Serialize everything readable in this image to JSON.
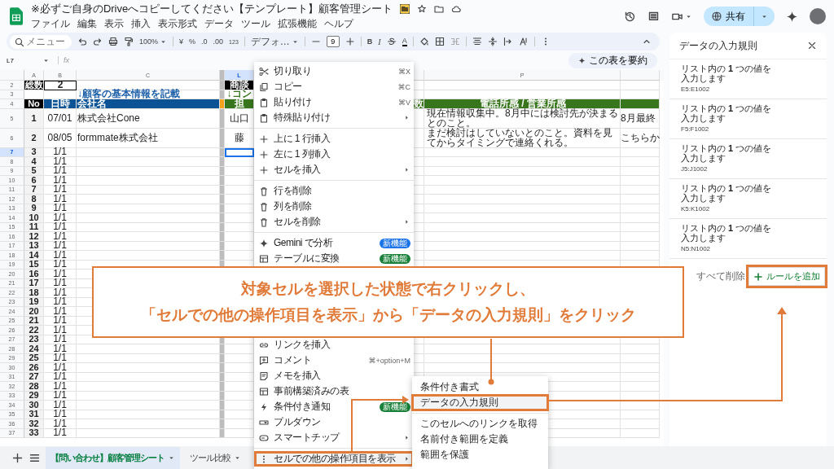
{
  "document": {
    "title": "※必ずご自身のDriveへコピーしてください【テンプレート】顧客管理シート",
    "menus": [
      "ファイル",
      "編集",
      "表示",
      "挿入",
      "表示形式",
      "データ",
      "ツール",
      "拡張機能",
      "ヘルプ"
    ],
    "share_label": "共有"
  },
  "toolbar": {
    "search_placeholder": "メニュー",
    "zoom": "100%",
    "currency": "¥",
    "percent": "%",
    "decrease_decimals": ".0",
    "increase_decimals": ".00",
    "number_format": "123",
    "font": "デフォ…",
    "font_size": "9",
    "bold": "B",
    "italic": "I",
    "text_color": "A"
  },
  "formula_bar": {
    "cell_ref": "L7",
    "fx": "fx",
    "summarize_button": "この表を要約"
  },
  "grid": {
    "column_headers": [
      {
        "letter": "A",
        "selected": false
      },
      {
        "letter": "B",
        "selected": false
      },
      {
        "letter": "C",
        "selected": false
      },
      {
        "letter": "L",
        "selected": true
      },
      {
        "letter": "P",
        "selected": false
      }
    ],
    "rows": [
      {
        "number": "2",
        "kind": "summary",
        "selected": false,
        "cells": {
          "A": "総数",
          "B": "2",
          "L": "商談"
        }
      },
      {
        "number": "3",
        "kind": "section",
        "selected": false,
        "cells": {
          "C": "↓顧客の基本情報を記載",
          "L": "↓コン"
        }
      },
      {
        "number": "4",
        "kind": "header",
        "selected": false,
        "cells": {
          "A": "No",
          "B": "日時",
          "C": "会社名",
          "L": "担",
          "O": "数",
          "P": "電話所感 / 営業所感"
        }
      },
      {
        "number": "5",
        "kind": "data",
        "selected": false,
        "cells": {
          "A": "1",
          "B": "07/01",
          "C": "株式会社Cone",
          "L": "山口",
          "P": "現在情報収集中。8月中には検討先が決まるとのこと。",
          "Q": "8月最終"
        }
      },
      {
        "number": "6",
        "kind": "data",
        "selected": false,
        "cells": {
          "A": "2",
          "B": "08/05",
          "C": "formmate株式会社",
          "L": "藤",
          "P": "まだ検討はしていないとのこと。資料を見てからタイミングで連絡くれる。",
          "Q": "こちらか"
        }
      },
      {
        "number": "7",
        "kind": "data",
        "selected": true,
        "cells": {
          "A": "3",
          "B": "1/1"
        }
      },
      {
        "number": "8",
        "kind": "data",
        "selected": false,
        "cells": {
          "A": "4",
          "B": "1/1"
        }
      },
      {
        "number": "9",
        "kind": "data",
        "selected": false,
        "cells": {
          "A": "5",
          "B": "1/1"
        }
      },
      {
        "number": "10",
        "kind": "data",
        "selected": false,
        "cells": {
          "A": "6",
          "B": "1/1"
        }
      },
      {
        "number": "11",
        "kind": "data",
        "selected": false,
        "cells": {
          "A": "7",
          "B": "1/1"
        }
      },
      {
        "number": "12",
        "kind": "data",
        "selected": false,
        "cells": {
          "A": "8",
          "B": "1/1"
        }
      },
      {
        "number": "13",
        "kind": "data",
        "selected": false,
        "cells": {
          "A": "9",
          "B": "1/1"
        }
      },
      {
        "number": "14",
        "kind": "data",
        "selected": false,
        "cells": {
          "A": "10",
          "B": "1/1"
        }
      },
      {
        "number": "15",
        "kind": "data",
        "selected": false,
        "cells": {
          "A": "11",
          "B": "1/1"
        }
      },
      {
        "number": "16",
        "kind": "data",
        "selected": false,
        "cells": {
          "A": "12",
          "B": "1/1"
        }
      },
      {
        "number": "17",
        "kind": "data",
        "selected": false,
        "cells": {
          "A": "13",
          "B": "1/1"
        }
      },
      {
        "number": "18",
        "kind": "data",
        "selected": false,
        "cells": {
          "A": "14",
          "B": "1/1"
        }
      },
      {
        "number": "19",
        "kind": "data",
        "selected": false,
        "cells": {
          "A": "15",
          "B": "1/1"
        }
      },
      {
        "number": "20",
        "kind": "data",
        "selected": false,
        "cells": {
          "A": "16",
          "B": "1/1"
        }
      },
      {
        "number": "21",
        "kind": "data",
        "selected": false,
        "cells": {
          "A": "17",
          "B": "1/1"
        }
      },
      {
        "number": "22",
        "kind": "data",
        "selected": false,
        "cells": {
          "A": "18",
          "B": "1/1"
        }
      },
      {
        "number": "23",
        "kind": "data",
        "selected": false,
        "cells": {
          "A": "19",
          "B": "1/1"
        }
      },
      {
        "number": "24",
        "kind": "data",
        "selected": false,
        "cells": {
          "A": "20",
          "B": "1/1"
        }
      },
      {
        "number": "25",
        "kind": "data",
        "selected": false,
        "cells": {
          "A": "21",
          "B": "1/1"
        }
      },
      {
        "number": "26",
        "kind": "data",
        "selected": false,
        "cells": {
          "A": "22",
          "B": "1/1"
        }
      },
      {
        "number": "27",
        "kind": "data",
        "selected": false,
        "cells": {
          "A": "23",
          "B": "1/1"
        }
      },
      {
        "number": "28",
        "kind": "data",
        "selected": false,
        "cells": {
          "A": "24",
          "B": "1/1"
        }
      },
      {
        "number": "29",
        "kind": "data",
        "selected": false,
        "cells": {
          "A": "25",
          "B": "1/1"
        }
      },
      {
        "number": "30",
        "kind": "data",
        "selected": false,
        "cells": {
          "A": "26",
          "B": "1/1"
        }
      },
      {
        "number": "31",
        "kind": "data",
        "selected": false,
        "cells": {
          "A": "27",
          "B": "1/1"
        }
      },
      {
        "number": "32",
        "kind": "data",
        "selected": false,
        "cells": {
          "A": "28",
          "B": "1/1"
        }
      },
      {
        "number": "33",
        "kind": "data",
        "selected": false,
        "cells": {
          "A": "29",
          "B": "1/1"
        }
      },
      {
        "number": "34",
        "kind": "data",
        "selected": false,
        "cells": {
          "A": "30",
          "B": "1/1"
        }
      },
      {
        "number": "35",
        "kind": "data",
        "selected": false,
        "cells": {
          "A": "31",
          "B": "1/1"
        }
      },
      {
        "number": "36",
        "kind": "data",
        "selected": false,
        "cells": {
          "A": "32",
          "B": "1/1"
        }
      },
      {
        "number": "37",
        "kind": "data",
        "selected": false,
        "cells": {
          "A": "33",
          "B": "1/1"
        }
      }
    ]
  },
  "context_menu": {
    "groups": [
      {
        "items": [
          {
            "label": "切り取り",
            "shortcut": "⌘X",
            "submenu": false,
            "highlighted": false
          },
          {
            "label": "コピー",
            "shortcut": "⌘C",
            "submenu": false,
            "highlighted": false
          },
          {
            "label": "貼り付け",
            "shortcut": "⌘V",
            "submenu": false,
            "highlighted": false
          },
          {
            "label": "特殊貼り付け",
            "submenu": true,
            "highlighted": false
          }
        ]
      },
      {
        "items": [
          {
            "label": "上に 1 行挿入",
            "submenu": false,
            "highlighted": false
          },
          {
            "label": "左に 1 列挿入",
            "submenu": false,
            "highlighted": false
          },
          {
            "label": "セルを挿入",
            "submenu": true,
            "highlighted": false
          }
        ]
      },
      {
        "items": [
          {
            "label": "行を削除",
            "submenu": false,
            "highlighted": false
          },
          {
            "label": "列を削除",
            "submenu": false,
            "highlighted": false
          },
          {
            "label": "セルを削除",
            "submenu": true,
            "highlighted": false
          }
        ]
      },
      {
        "items": [
          {
            "label": "Gemini で分析",
            "badge": {
              "text": "新機能",
              "color": "#1a73e8"
            },
            "submenu": false,
            "highlighted": false
          },
          {
            "label": "テーブルに変換",
            "badge": {
              "text": "新機能",
              "color": "#188038"
            },
            "submenu": false,
            "highlighted": false
          }
        ]
      },
      {
        "items": [
          {
            "label": "リンクを挿入",
            "submenu": false,
            "highlighted": false
          },
          {
            "label": "コメント",
            "shortcut": "⌘+option+M",
            "submenu": false,
            "highlighted": false
          },
          {
            "label": "メモを挿入",
            "submenu": false,
            "highlighted": false
          },
          {
            "label": "事前構築済みの表",
            "submenu": false,
            "highlighted": false
          },
          {
            "label": "条件付き通知",
            "badge": {
              "text": "新機能",
              "color": "#188038"
            },
            "submenu": false,
            "highlighted": false
          },
          {
            "label": "プルダウン",
            "submenu": false,
            "highlighted": false
          },
          {
            "label": "スマートチップ",
            "submenu": true,
            "highlighted": false
          }
        ]
      },
      {
        "items": [
          {
            "label": "セルでの他の操作項目を表示",
            "submenu": true,
            "highlighted": true
          }
        ]
      }
    ]
  },
  "submenu": {
    "groups": [
      {
        "items": [
          {
            "label": "条件付き書式",
            "highlighted": false
          },
          {
            "label": "データの入力規則",
            "highlighted": true
          }
        ]
      },
      {
        "items": [
          {
            "label": "このセルへのリンクを取得",
            "highlighted": false
          },
          {
            "label": "名前付き範囲を定義",
            "highlighted": false
          },
          {
            "label": "範囲を保護",
            "highlighted": false
          }
        ]
      }
    ]
  },
  "side_panel": {
    "title": "データの入力規則",
    "rules": [
      {
        "description": "リスト内の **1** つの値を入力します",
        "range": "E5:E1002"
      },
      {
        "description": "リスト内の **1** つの値を入力します",
        "range": "F5:F1002"
      },
      {
        "description": "リスト内の **1** つの値を入力します",
        "range": "J5:J1002"
      },
      {
        "description": "リスト内の **1** つの値を入力します",
        "range": "K5:K1002"
      },
      {
        "description": "リスト内の **1** つの値を入力します",
        "range": "N5:N1002"
      }
    ],
    "remove_all": "すべて削除",
    "add_rule": {
      "label": "ルールを追加",
      "highlighted": true
    }
  },
  "annotation": {
    "lines": [
      "対象セルを選択した状態で右クリックし、",
      "「セルでの他の操作項目を表示」から「データの入力規則」をクリック"
    ]
  },
  "sheet_tabs": [
    {
      "label": "【問い合わせ】顧客管理シート",
      "selected": true
    },
    {
      "label": "ツール比較",
      "selected": false
    }
  ]
}
